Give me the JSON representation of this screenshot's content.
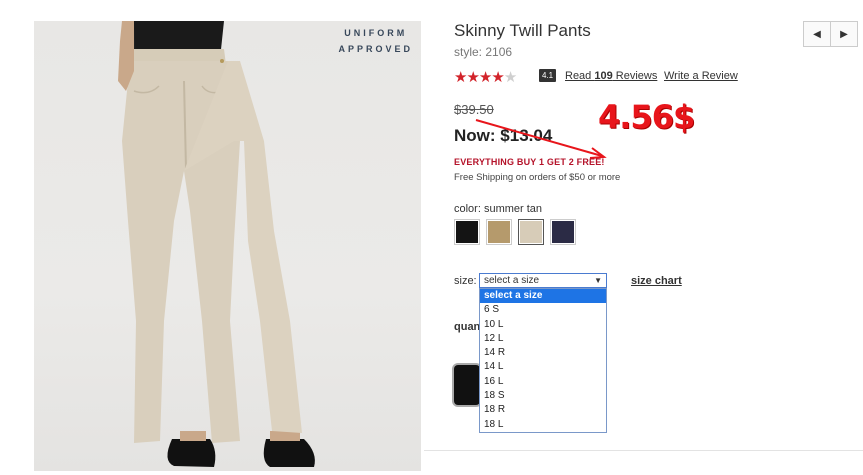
{
  "product": {
    "badge_line1": "UNIFORM",
    "badge_line2": "APPROVED",
    "title": "Skinny Twill Pants",
    "style": "style: 2106",
    "rating_value": "4.1",
    "rating_stars": 4,
    "reviews_prefix": "Read ",
    "reviews_count": "109",
    "reviews_suffix": " Reviews",
    "write_review": "Write a Review",
    "old_price": "$39.50",
    "now_label": "Now: ",
    "now_price": "$13.04",
    "promo": "EVERYTHING BUY 1 GET 2 FREE!",
    "shipping": "Free Shipping on orders of $50 or more",
    "overlay_price": "4.56$"
  },
  "nav": {
    "prev": "◀",
    "next": "▶"
  },
  "color": {
    "label": "color: summer tan",
    "swatches": [
      {
        "name": "black",
        "hex": "#141414",
        "selected": false
      },
      {
        "name": "khaki",
        "hex": "#b59a6c",
        "selected": false
      },
      {
        "name": "summer tan",
        "hex": "#d7ccb8",
        "selected": true
      },
      {
        "name": "navy",
        "hex": "#2b2b45",
        "selected": false
      }
    ]
  },
  "size": {
    "label": "size:",
    "selected": "select a size",
    "chart_link": "size chart",
    "options": [
      "select a size",
      "6 S",
      "10 L",
      "12 L",
      "14 R",
      "14 L",
      "16 L",
      "18 S",
      "18 R",
      "18 L"
    ]
  },
  "quantity": {
    "label": "quan"
  }
}
